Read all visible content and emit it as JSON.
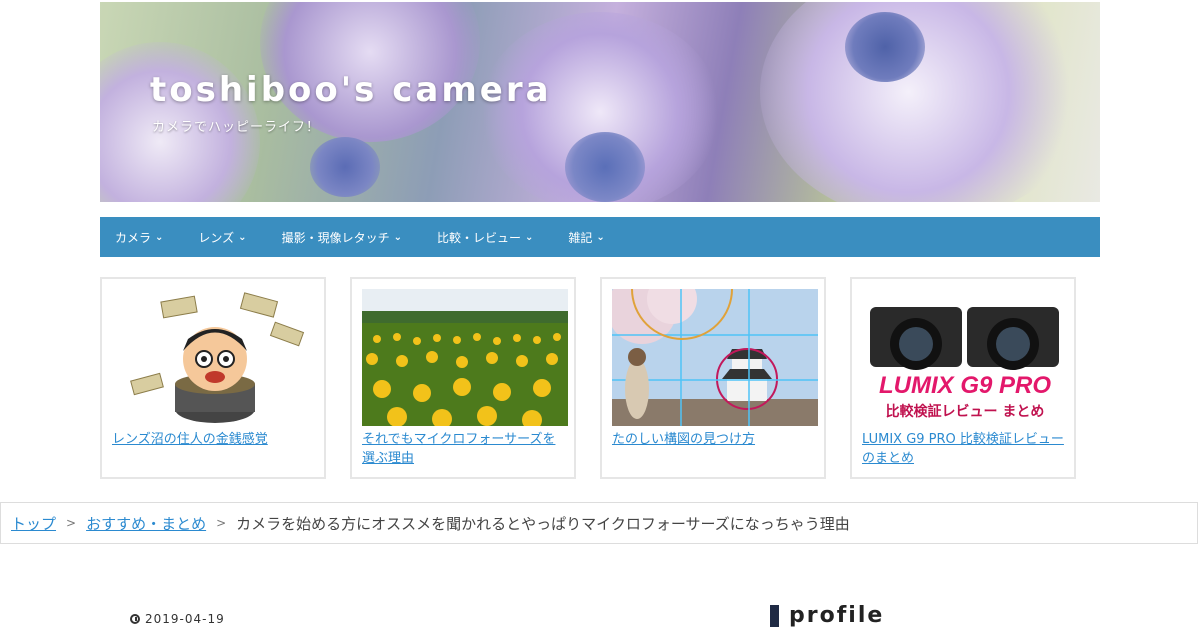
{
  "header": {
    "title": "toshiboo's camera",
    "tagline": "カメラでハッピーライフ！"
  },
  "nav": {
    "items": [
      {
        "label": "カメラ"
      },
      {
        "label": "レンズ"
      },
      {
        "label": "撮影・現像レタッチ"
      },
      {
        "label": "比較・レビュー"
      },
      {
        "label": "雑記"
      }
    ],
    "color": "#3a8ec0"
  },
  "cards": [
    {
      "title": "レンズ沼の住人の金銭感覚",
      "image": "money-cartoon"
    },
    {
      "title": "それでもマイクロフォーサーズを選ぶ理由",
      "image": "sunflower-field"
    },
    {
      "title": "たのしい構図の見つけ方",
      "image": "castle-composition"
    },
    {
      "title": "LUMIX G9 PRO 比較検証レビューのまとめ",
      "image": "lumix-cameras",
      "image_text": "LUMIX G9 PRO 比較検証レビュー まとめ"
    }
  ],
  "breadcrumb": {
    "items": [
      "トップ",
      "おすすめ・まとめ"
    ],
    "separator": ">",
    "current": "カメラを始める方にオススメを聞かれるとやっぱりマイクロフォーサーズになっちゃう理由"
  },
  "post": {
    "date": "2019-04-19"
  },
  "sidebar": {
    "title": "profile"
  },
  "colors": {
    "link": "#2b8ad0",
    "nav_bg": "#3a8ec0"
  }
}
